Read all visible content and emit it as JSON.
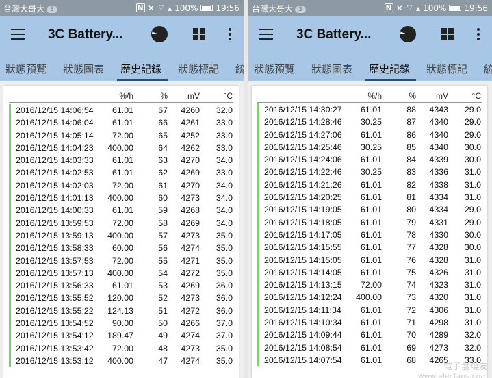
{
  "status_bar": {
    "carrier": "台灣大哥大",
    "badge": "3",
    "battery": "100%",
    "time": "19:56"
  },
  "app": {
    "title": "3C Battery...",
    "tabs": [
      "狀態預覽",
      "狀態圖表",
      "歷史記錄",
      "狀態標記",
      "統"
    ],
    "active_tab": "歷史記錄"
  },
  "columns": {
    "rate": "%/h",
    "pct": "%",
    "mv": "mV",
    "temp": "°C"
  },
  "left": {
    "rows": [
      [
        "2016/12/15 14:06:54",
        "61.01",
        "67",
        "4260",
        "32.0"
      ],
      [
        "2016/12/15 14:06:04",
        "61.01",
        "66",
        "4261",
        "33.0"
      ],
      [
        "2016/12/15 14:05:14",
        "72.00",
        "65",
        "4252",
        "33.0"
      ],
      [
        "2016/12/15 14:04:23",
        "400.00",
        "64",
        "4262",
        "33.0"
      ],
      [
        "2016/12/15 14:03:33",
        "61.01",
        "63",
        "4270",
        "34.0"
      ],
      [
        "2016/12/15 14:02:53",
        "61.01",
        "62",
        "4269",
        "33.0"
      ],
      [
        "2016/12/15 14:02:03",
        "72.00",
        "61",
        "4270",
        "34.0"
      ],
      [
        "2016/12/15 14:01:13",
        "400.00",
        "60",
        "4273",
        "34.0"
      ],
      [
        "2016/12/15 14:00:33",
        "61.01",
        "59",
        "4268",
        "34.0"
      ],
      [
        "2016/12/15 13:59:53",
        "72.00",
        "58",
        "4269",
        "34.0"
      ],
      [
        "2016/12/15 13:59:13",
        "400.00",
        "57",
        "4273",
        "35.0"
      ],
      [
        "2016/12/15 13:58:33",
        "60.00",
        "56",
        "4274",
        "35.0"
      ],
      [
        "2016/12/15 13:57:53",
        "72.00",
        "55",
        "4271",
        "35.0"
      ],
      [
        "2016/12/15 13:57:13",
        "400.00",
        "54",
        "4272",
        "35.0"
      ],
      [
        "2016/12/15 13:56:33",
        "61.01",
        "53",
        "4269",
        "36.0"
      ],
      [
        "2016/12/15 13:55:52",
        "120.00",
        "52",
        "4273",
        "36.0"
      ],
      [
        "2016/12/15 13:55:22",
        "124.13",
        "51",
        "4272",
        "36.0"
      ],
      [
        "2016/12/15 13:54:52",
        "90.00",
        "50",
        "4266",
        "37.0"
      ],
      [
        "2016/12/15 13:54:12",
        "189.47",
        "49",
        "4274",
        "37.0"
      ],
      [
        "2016/12/15 13:53:42",
        "72.00",
        "48",
        "4273",
        "35.0"
      ],
      [
        "2016/12/15 13:53:12",
        "400.00",
        "47",
        "4274",
        "35.0"
      ]
    ]
  },
  "right": {
    "rows": [
      [
        "2016/12/15 14:30:27",
        "61.01",
        "88",
        "4343",
        "29.0"
      ],
      [
        "2016/12/15 14:28:46",
        "30.25",
        "87",
        "4340",
        "29.0"
      ],
      [
        "2016/12/15 14:27:06",
        "61.01",
        "86",
        "4340",
        "29.0"
      ],
      [
        "2016/12/15 14:25:46",
        "30.25",
        "85",
        "4340",
        "30.0"
      ],
      [
        "2016/12/15 14:24:06",
        "61.01",
        "84",
        "4339",
        "30.0"
      ],
      [
        "2016/12/15 14:22:46",
        "30.25",
        "83",
        "4336",
        "31.0"
      ],
      [
        "2016/12/15 14:21:26",
        "61.01",
        "82",
        "4338",
        "31.0"
      ],
      [
        "2016/12/15 14:20:25",
        "61.01",
        "81",
        "4334",
        "31.0"
      ],
      [
        "2016/12/15 14:19:05",
        "61.01",
        "80",
        "4334",
        "29.0"
      ],
      [
        "2016/12/15 14:18:05",
        "61.01",
        "79",
        "4331",
        "29.0"
      ],
      [
        "2016/12/15 14:17:05",
        "61.01",
        "78",
        "4330",
        "30.0"
      ],
      [
        "2016/12/15 14:15:55",
        "61.01",
        "77",
        "4328",
        "30.0"
      ],
      [
        "2016/12/15 14:15:05",
        "61.01",
        "76",
        "4328",
        "31.0"
      ],
      [
        "2016/12/15 14:14:05",
        "61.01",
        "75",
        "4326",
        "31.0"
      ],
      [
        "2016/12/15 14:13:15",
        "72.00",
        "74",
        "4323",
        "31.0"
      ],
      [
        "2016/12/15 14:12:24",
        "400.00",
        "73",
        "4320",
        "31.0"
      ],
      [
        "2016/12/15 14:11:34",
        "61.01",
        "72",
        "4306",
        "31.0"
      ],
      [
        "2016/12/15 14:10:34",
        "61.01",
        "71",
        "4298",
        "31.0"
      ],
      [
        "2016/12/15 14:09:44",
        "61.01",
        "70",
        "4289",
        "32.0"
      ],
      [
        "2016/12/15 14:08:54",
        "61.01",
        "69",
        "4273",
        "32.0"
      ],
      [
        "2016/12/15 14:07:54",
        "61.01",
        "68",
        "4265",
        "33.0"
      ]
    ]
  },
  "icons": {
    "menu": "hamburger-menu-icon",
    "chart": "pie-chart-icon",
    "grid": "grid-view-icon",
    "more": "more-vert-icon"
  },
  "colors": {
    "app_bar": "#a8c6e5",
    "status_bar": "#8e9aa3",
    "row_marker": "#7ccf6c",
    "tab_underline": "#2a4f7a"
  }
}
